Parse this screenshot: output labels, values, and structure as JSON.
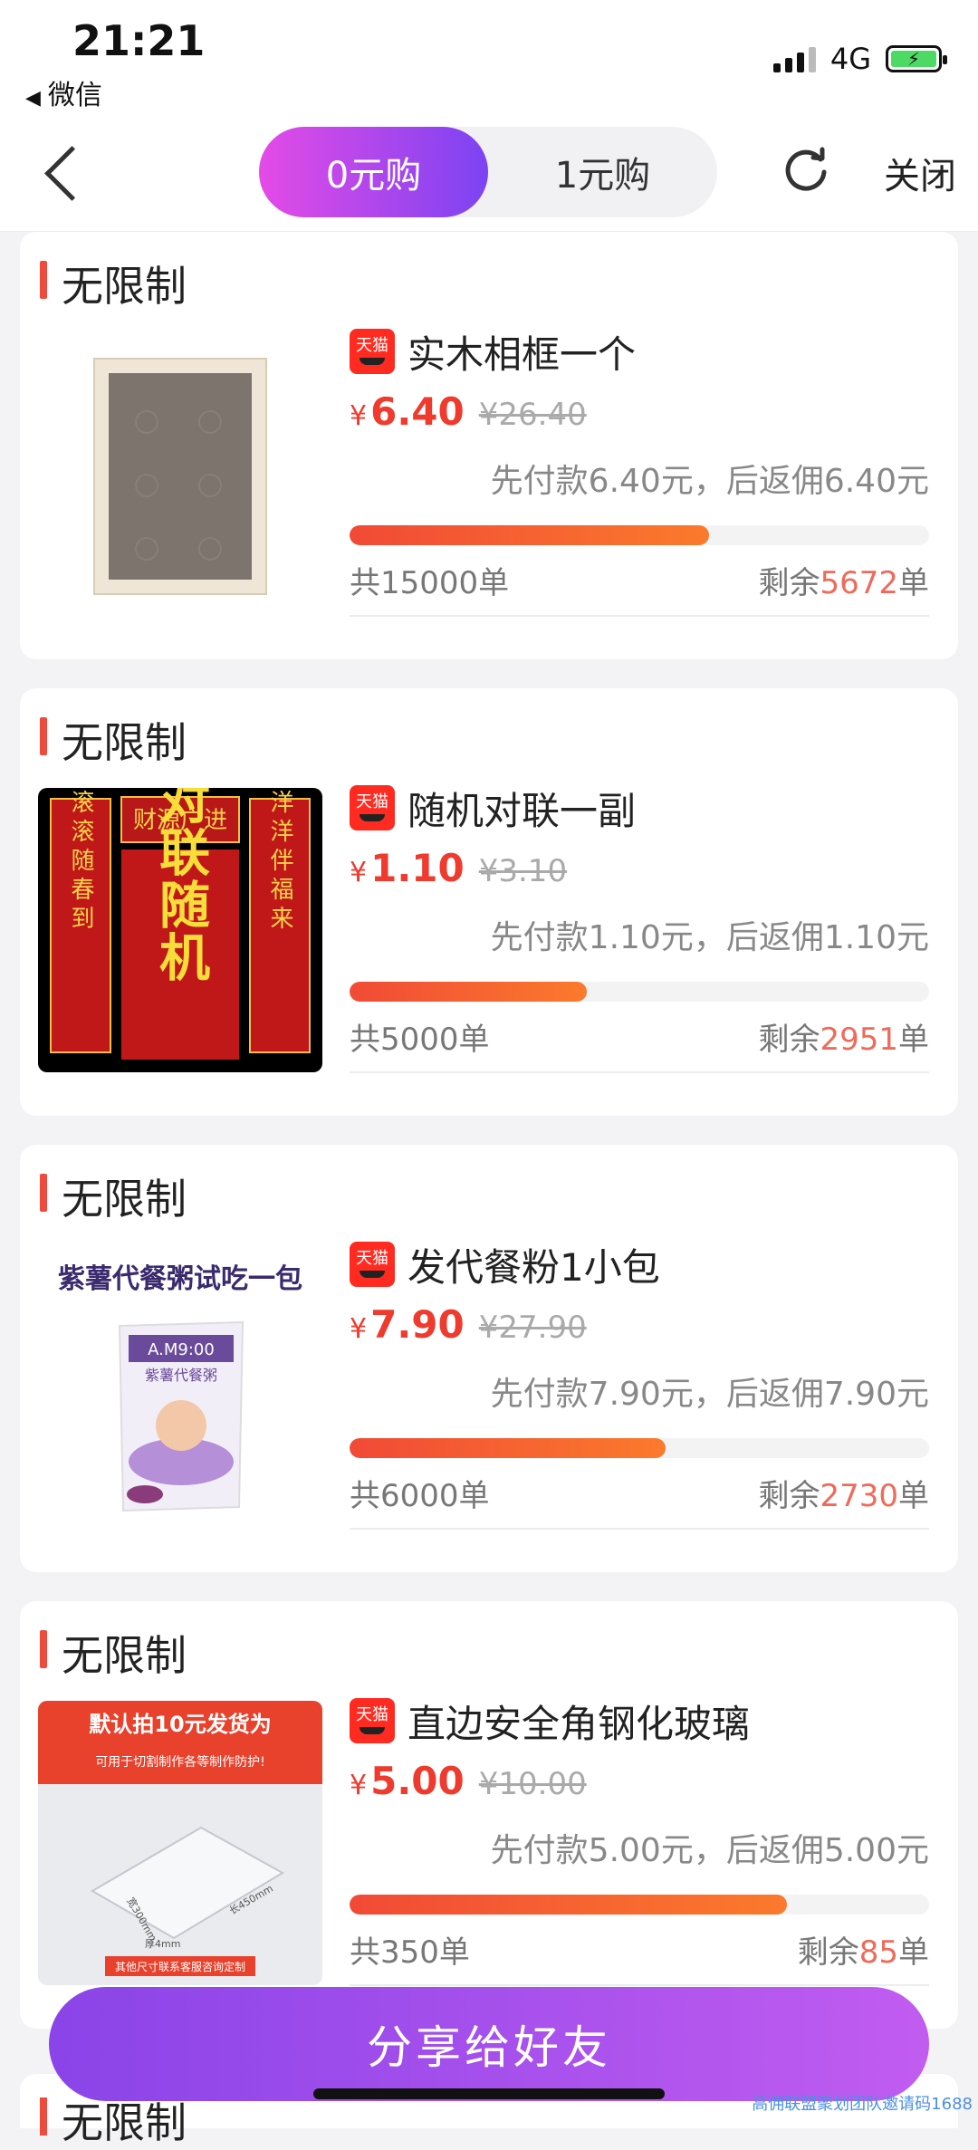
{
  "status_bar": {
    "time": "21:21",
    "back_app": "微信",
    "network": "4G"
  },
  "nav": {
    "tabs": [
      {
        "label": "0元购",
        "active": true
      },
      {
        "label": "1元购",
        "active": false
      }
    ],
    "close_label": "关闭"
  },
  "platform_badge": "天猫",
  "currency": "¥",
  "items": [
    {
      "tag": "无限制",
      "title": "实木相框一个",
      "price": "6.40",
      "original_price": "¥26.40",
      "rebate_text": "先付款6.40元，后返佣6.40元",
      "progress": 0.62,
      "total_text": "共15000单",
      "remaining_label": "剩余",
      "remaining": "5672",
      "remaining_unit": "单"
    },
    {
      "tag": "无限制",
      "title": "随机对联一副",
      "price": "1.10",
      "original_price": "¥3.10",
      "rebate_text": "先付款1.10元，后返佣1.10元",
      "progress": 0.41,
      "total_text": "共5000单",
      "remaining_label": "剩余",
      "remaining": "2951",
      "remaining_unit": "单"
    },
    {
      "tag": "无限制",
      "title": "发代餐粉1小包",
      "price": "7.90",
      "original_price": "¥27.90",
      "rebate_text": "先付款7.90元，后返佣7.90元",
      "progress": 0.545,
      "total_text": "共6000单",
      "remaining_label": "剩余",
      "remaining": "2730",
      "remaining_unit": "单"
    },
    {
      "tag": "无限制",
      "title": "直边安全角钢化玻璃",
      "price": "5.00",
      "original_price": "¥10.00",
      "rebate_text": "先付款5.00元，后返佣5.00元",
      "progress": 0.755,
      "total_text": "共350单",
      "remaining_label": "剩余",
      "remaining": "85",
      "remaining_unit": "单"
    }
  ],
  "images": {
    "couplet": {
      "top": "财源广进",
      "left": "财源滚滚随春到",
      "right": "喜气洋洋伴福来",
      "center": "对联随机"
    },
    "meal": {
      "banner": "紫薯代餐粥试吃一包",
      "pack_label": "A.M9:00",
      "pack_sub": "紫薯代餐粥"
    },
    "glass": {
      "banner": "默认拍10元发货为",
      "line2": "可用于切割制作各等制作防护!",
      "footer": "其他尺寸联系客服咨询定制",
      "dim_a": "宽300mm",
      "dim_b": "长450mm",
      "dim_c": "厚4mm"
    }
  },
  "peek_tag": "无限制",
  "share_label": "分享给好友",
  "watermark": "高佣联盟聚划团队邀请码1688"
}
